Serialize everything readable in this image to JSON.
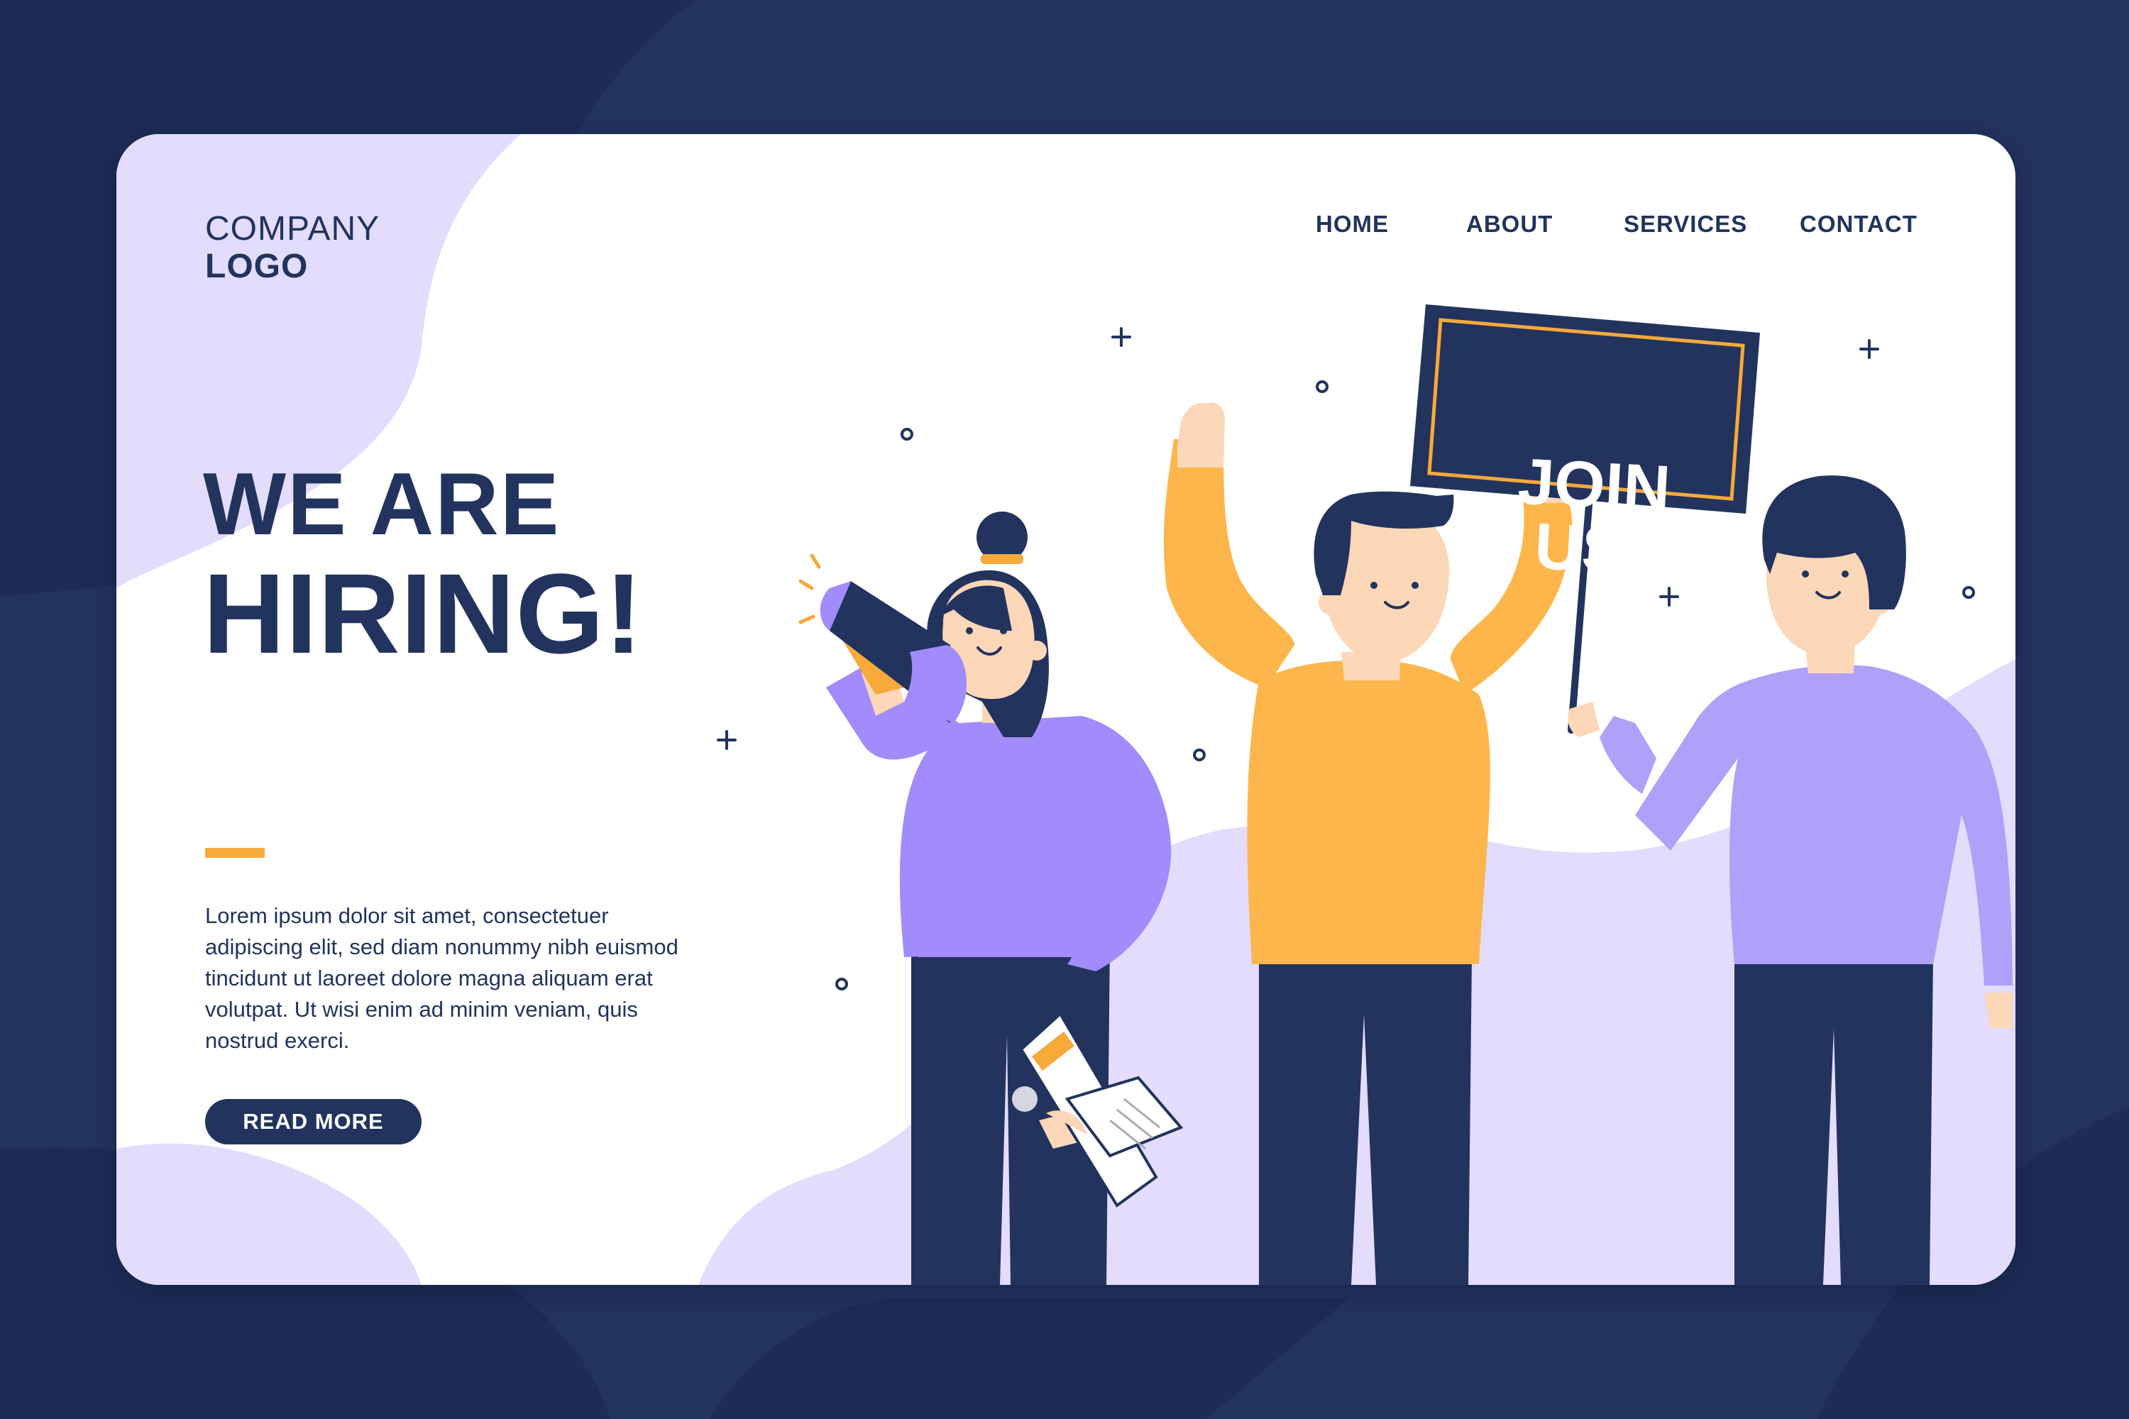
{
  "brand": {
    "line1": "COMPANY",
    "line2": "LOGO"
  },
  "nav": {
    "items": [
      {
        "label": "HOME"
      },
      {
        "label": "ABOUT"
      },
      {
        "label": "SERVICES"
      },
      {
        "label": "CONTACT"
      }
    ]
  },
  "hero": {
    "headline_line1": "WE ARE",
    "headline_line2": "HIRING!",
    "body": "Lorem ipsum dolor sit amet, consectetuer adipiscing elit, sed diam nonummy nibh euismod tincidunt ut laoreet dolore magna aliquam erat volutpat. Ut wisi enim ad minim veniam, quis nostrud exerci.",
    "cta_label": "READ MORE"
  },
  "sign": {
    "line1": "JOIN",
    "line2": "US!"
  },
  "colors": {
    "navy": "#22335e",
    "page_background": "#22335e",
    "lavender": "#e3dcfd",
    "purple": "#a28bfb",
    "orange": "#fdb64b",
    "accent": "#f7a93a",
    "skin": "#fcd7b8",
    "white": "#ffffff"
  },
  "icons": [
    "megaphone-icon",
    "clipboard-icon",
    "sparkle-plus-icon",
    "sparkle-circle-icon"
  ]
}
